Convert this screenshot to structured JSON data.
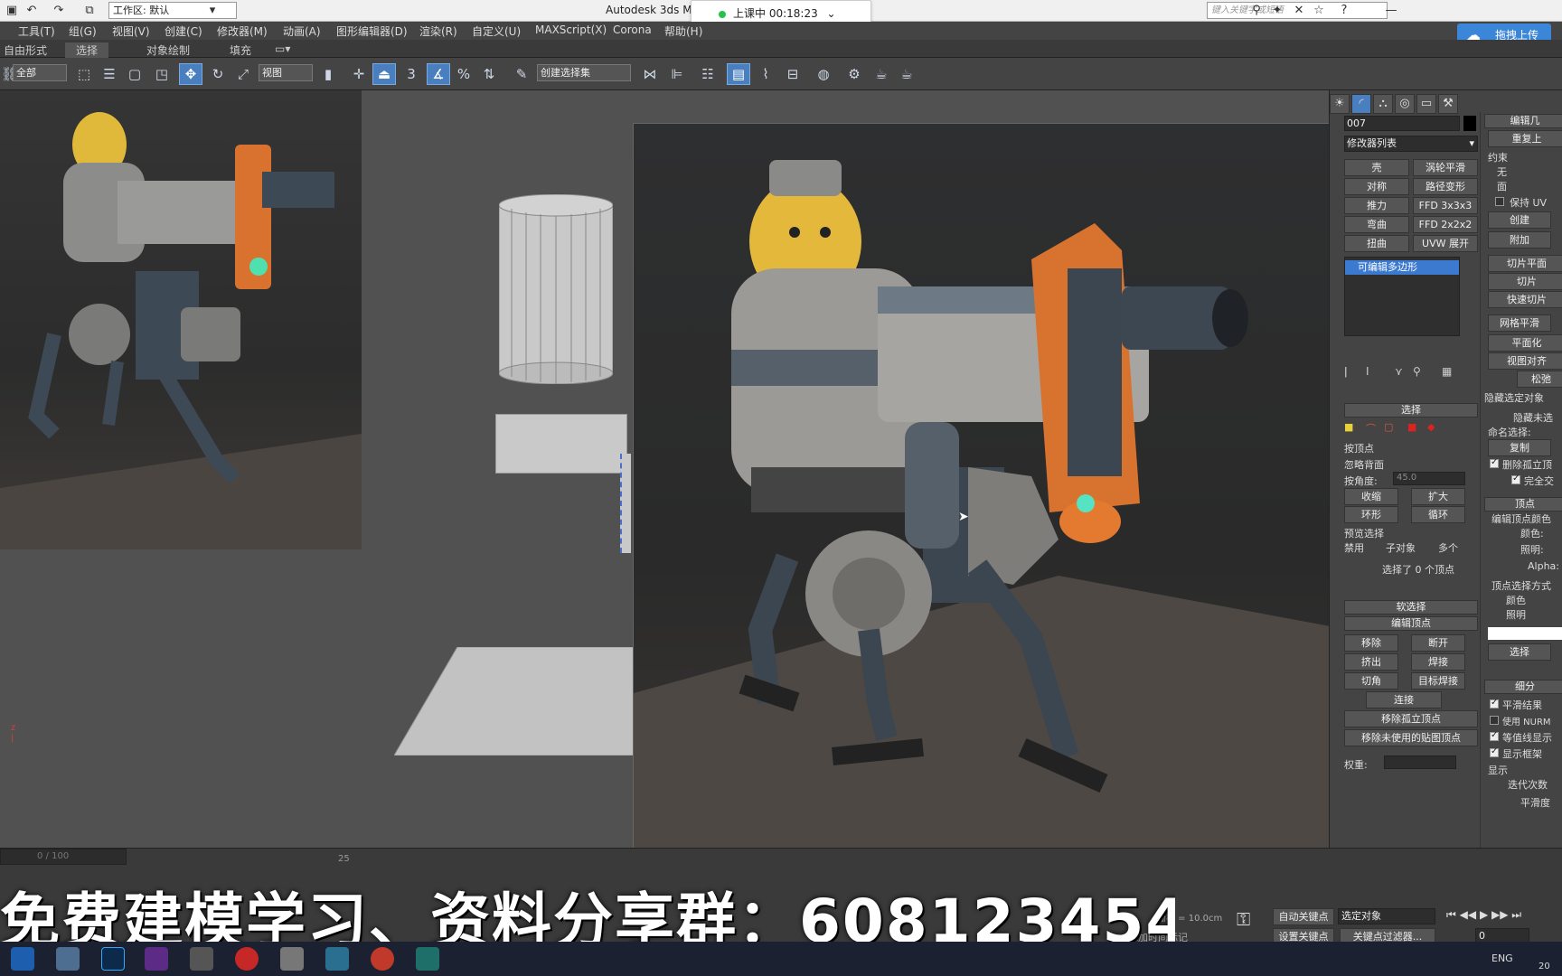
{
  "titlebar": {
    "workspace_label": "工作区: 默认",
    "app_title": "Autodesk 3ds M",
    "timer_text": "上课中 00:18:23",
    "search_placeholder": "键入关键字或短语"
  },
  "menu": {
    "items": [
      "工具(T)",
      "组(G)",
      "视图(V)",
      "创建(C)",
      "修改器(M)",
      "动画(A)",
      "图形编辑器(D)",
      "渲染(R)",
      "自定义(U)",
      "MAXScript(X)",
      "Corona",
      "帮助(H)"
    ]
  },
  "upload_button": "拖拽上传",
  "ribbon": {
    "tabs": [
      "自由形式",
      "选择",
      "对象绘制",
      "填充"
    ]
  },
  "toolbar": {
    "filter_select": "全部",
    "coord_select": "视图",
    "selection_set": "创建选择集",
    "snap_angle_label": "3"
  },
  "command_panel": {
    "object_name": "007",
    "modifier_list": "修改器列表",
    "modifier_buttons": [
      "壳",
      "涡轮平滑",
      "对称",
      "路径变形",
      "推力",
      "FFD 3x3x3",
      "弯曲",
      "FFD 2x2x2",
      "扭曲",
      "UVW 展开"
    ],
    "stack_item": "可编辑多边形",
    "selection_rollout": "选择",
    "by_vertex": "按顶点",
    "ignore_backfacing": "忽略背面",
    "by_angle": "按角度:",
    "by_angle_value": "45.0",
    "shrink": "收缩",
    "grow": "扩大",
    "ring": "环形",
    "loop": "循环",
    "preview_selection": "预览选择",
    "disabled": "禁用",
    "sub_object": "子对象",
    "multi": "多个",
    "selected_count": "选择了 0 个顶点",
    "soft_selection": "软选择",
    "edit_vertices": "编辑顶点",
    "remove": "移除",
    "break": "断开",
    "extrude": "挤出",
    "weld": "焊接",
    "chamfer": "切角",
    "target_weld": "目标焊接",
    "connect": "连接",
    "remove_isolated": "移除孤立顶点",
    "remove_unused": "移除未使用的贴图顶点",
    "weight": "权重:"
  },
  "graphite_panel": {
    "edit_header": "编辑几",
    "repeat": "重复上",
    "constraints": "约束",
    "none": "无",
    "face": "面",
    "preserve_uv": "保持 UV",
    "create": "创建",
    "attach": "附加",
    "slice_plane": "切片平面",
    "slice": "切片",
    "quick_slice": "快速切片",
    "meshsmooth": "网格平滑",
    "planarize": "平面化",
    "view_align": "视图对齐",
    "relax": "松弛",
    "hide_selected": "隐藏选定对象",
    "hide_unselected": "隐藏未选",
    "named_selection": "命名选择:",
    "copy": "复制",
    "delete_isolated": "删除孤立顶",
    "full_interactive": "完全交",
    "vertex_header": "顶点",
    "edit_vertex_color": "编辑顶点颜色",
    "color": "颜色:",
    "illumination": "照明:",
    "alpha": "Alpha:",
    "vertex_select_by": "顶点选择方式",
    "by_color": "颜色",
    "by_illum": "照明",
    "select": "选择",
    "subdivision_header": "细分",
    "smooth_result": "平滑结果",
    "use_nurms": "使用 NURM",
    "isoline_display": "等值线显示",
    "show_cage": "显示框架",
    "display": "显示",
    "iterations": "迭代次数",
    "smoothness": "平滑度"
  },
  "status": {
    "frame_counter": "0 / 100",
    "ruler_mark": "25",
    "grid": "栅格 = 10.0cm",
    "add_time_tag": "添加时间标记",
    "auto_key": "自动关键点",
    "set_key": "设置关键点",
    "selected_object": "选定对象",
    "key_filters": "关键点过滤器...",
    "frame_value": "0"
  },
  "overlay_text": "免费建模学习、资料分享群：608123454",
  "taskbar": {
    "lang": "ENG",
    "year_fragment": "20"
  }
}
